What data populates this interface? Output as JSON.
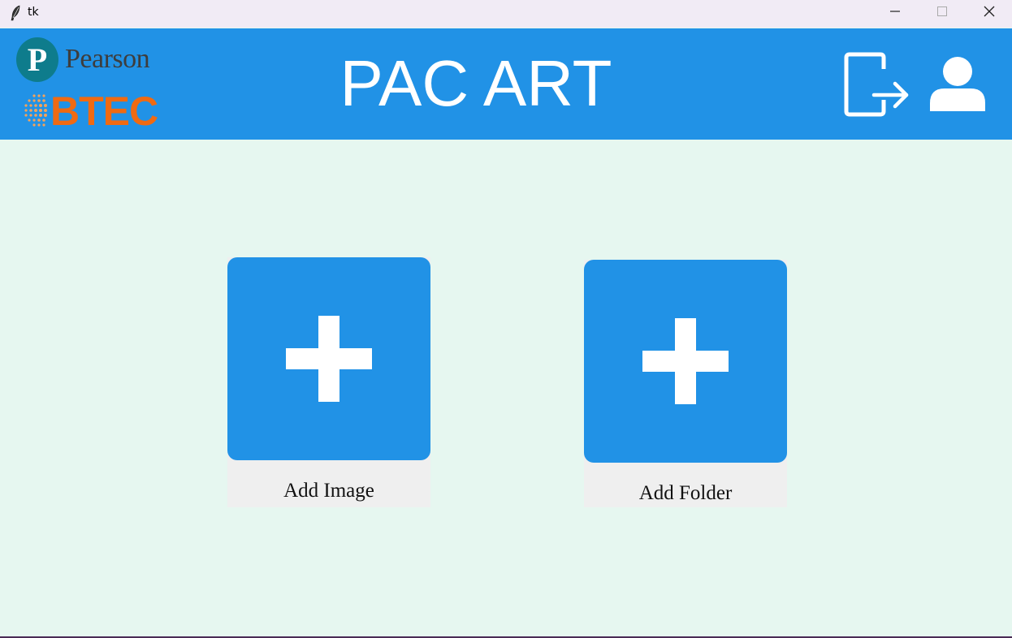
{
  "window": {
    "title": "tk",
    "icon": "feather-icon",
    "controls": [
      "minimize-icon",
      "maximize-icon",
      "close-icon"
    ]
  },
  "header": {
    "logo_top": "Pearson",
    "logo_bottom": "BTEC",
    "title": "PAC ART",
    "logout_icon": "logout-icon",
    "profile_icon": "user-icon"
  },
  "cards": {
    "image": {
      "label": "Add Image",
      "icon": "plus-icon"
    },
    "folder": {
      "label": "Add Folder",
      "icon": "plus-icon"
    }
  },
  "colors": {
    "header_bg": "#2192e6",
    "content_bg": "#e6f7f0",
    "titlebar_bg": "#f1ebf5",
    "tile_bg": "#2192e6",
    "label_bg": "#efefef",
    "btec_orange": "#f06a12",
    "pearson_teal": "#0e7c8c"
  }
}
